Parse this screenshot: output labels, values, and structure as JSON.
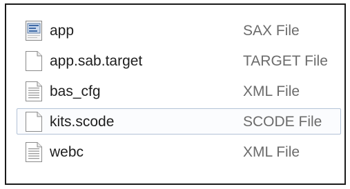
{
  "files": [
    {
      "name": "app",
      "type": "SAX File",
      "icon": "sax-file-icon",
      "focused": false
    },
    {
      "name": "app.sab.target",
      "type": "TARGET File",
      "icon": "blank-file-icon",
      "focused": false
    },
    {
      "name": "bas_cfg",
      "type": "XML File",
      "icon": "xml-file-icon",
      "focused": false
    },
    {
      "name": "kits.scode",
      "type": "SCODE File",
      "icon": "blank-file-icon",
      "focused": true
    },
    {
      "name": "webc",
      "type": "XML File",
      "icon": "xml-file-icon",
      "focused": false
    }
  ],
  "colors": {
    "focus_border": "#b2c2d6",
    "name_text": "#1e1e1e",
    "type_text": "#6b6b6b",
    "frame_border": "#1a1a1a"
  }
}
